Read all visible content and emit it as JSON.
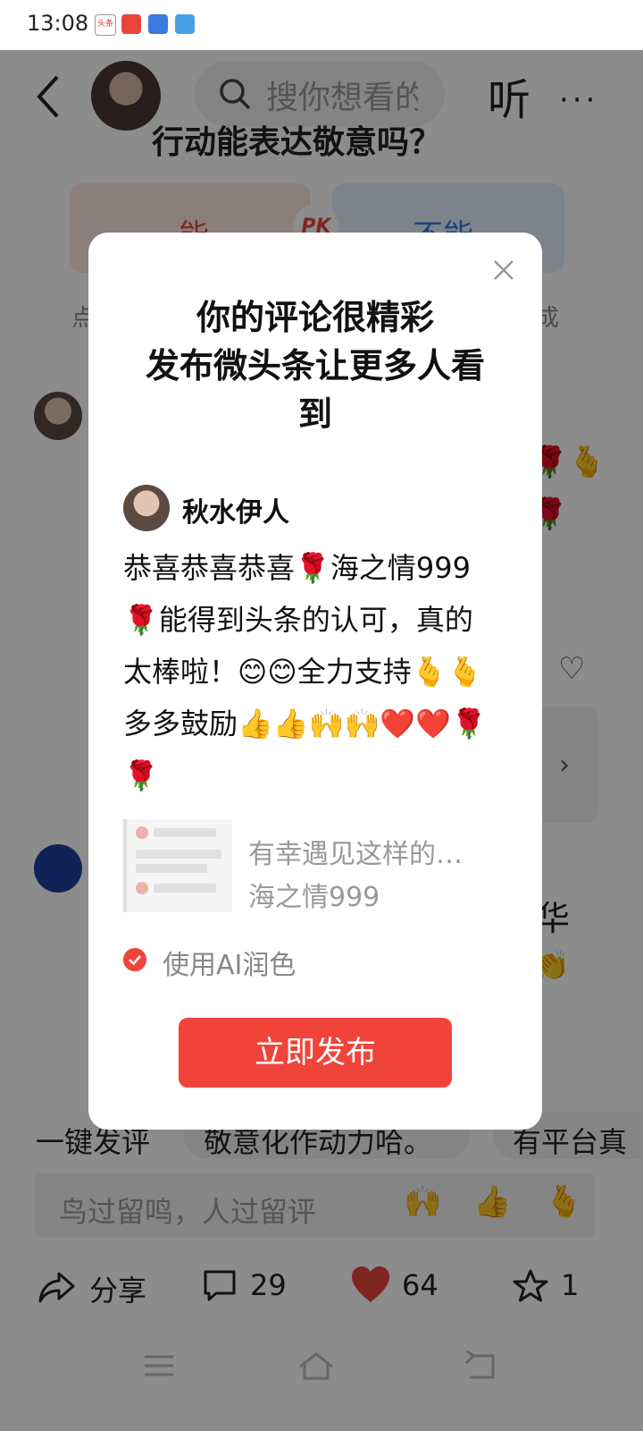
{
  "status_bar": {
    "time": "13:08",
    "icons": [
      "toutiao-app-icon",
      "news-app-icon",
      "browser-app-icon",
      "send-icon"
    ],
    "toutiao_icon_text": "头条"
  },
  "header": {
    "search_placeholder": "搜你想看的",
    "listen_label": "听",
    "more_label": "···"
  },
  "article": {
    "question_fragment": "行动能表达敬意吗？",
    "pk": {
      "left_label": "能",
      "badge": "PK",
      "right_label": "不能"
    },
    "hint_left": "点",
    "hint_right": "成",
    "emoji_column": "🌹🫰🌹",
    "card_arrow": "›",
    "hua_fragment": "华",
    "hand_fragment": "👏"
  },
  "quick_comments": {
    "one_key_label": "一键发评",
    "chips": [
      "敬意化作动力哈。",
      "有平台真"
    ]
  },
  "comment_input": {
    "placeholder": "鸟过留鸣，人过留评",
    "emoji_1": "🙌",
    "emoji_2": "👍",
    "emoji_3": "🫰"
  },
  "bottom_bar": {
    "share_label": "分享",
    "comment_count": "29",
    "like_count": "64",
    "favorite_count": "1"
  },
  "modal": {
    "title": "你的评论很精彩\n发布微头条让更多人看\n到",
    "username": "秋水伊人",
    "comment_text": "恭喜恭喜恭喜🌹海之情999🌹能得到头条的认可，真的太棒啦！😊😊全力支持🫰🫰多多鼓励👍👍🙌🙌❤️❤️🌹🌹",
    "quote_title": "有幸遇见这样的…",
    "quote_source": "海之情999",
    "ai_label": "使用AI润色",
    "ai_checked": true,
    "publish_label": "立即发布"
  },
  "colors": {
    "accent": "#f0443a",
    "pk_blue": "#3b7be0",
    "overlay": "rgba(0,0,0,0.45)"
  }
}
